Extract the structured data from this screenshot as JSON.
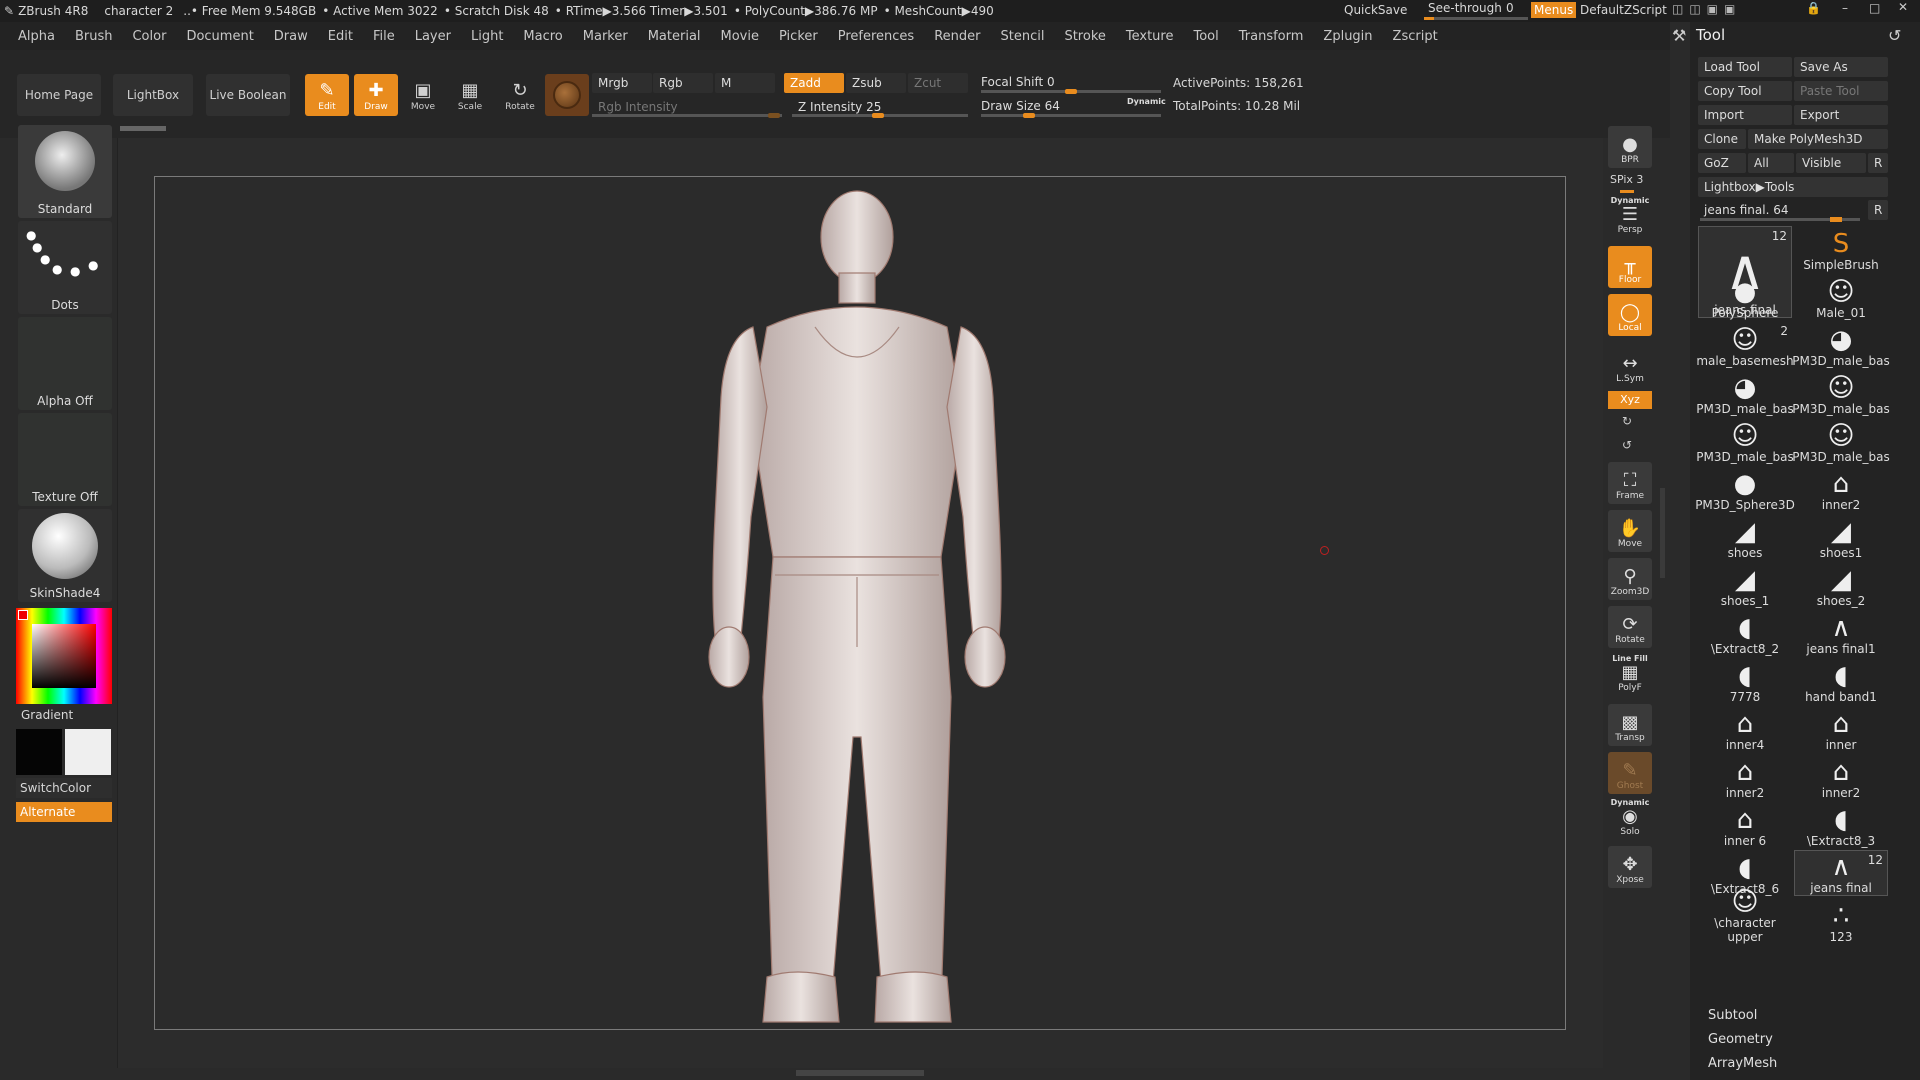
{
  "titlebar": {
    "app": "ZBrush 4R8",
    "doc": "character  2",
    "free_mem": "..• Free Mem 9.548GB",
    "active_mem": "• Active Mem 3022",
    "scratch": "• Scratch Disk 48",
    "rtime": "• RTime▶3.566 Timer▶3.501",
    "polycount": "• PolyCount▶386.76 MP",
    "meshcount": "• MeshCount▶490",
    "quicksave": "QuickSave",
    "seethrough": "See-through",
    "seethrough_value": "0",
    "menus": "Menus",
    "script": "DefaultZScript"
  },
  "menubar": [
    "Alpha",
    "Brush",
    "Color",
    "Document",
    "Draw",
    "Edit",
    "File",
    "Layer",
    "Light",
    "Macro",
    "Marker",
    "Material",
    "Movie",
    "Picker",
    "Preferences",
    "Render",
    "Stencil",
    "Stroke",
    "Texture",
    "Tool",
    "Transform",
    "Zplugin",
    "Zscript"
  ],
  "toolbar": {
    "home_page": "Home Page",
    "lightbox": "LightBox",
    "live_boolean": "Live Boolean",
    "edit": "Edit",
    "draw": "Draw",
    "move": "Move",
    "scale": "Scale",
    "rotate": "Rotate",
    "mrgb": "Mrgb",
    "rgb": "Rgb",
    "m": "M",
    "rgb_intensity": "Rgb Intensity",
    "zadd": "Zadd",
    "zsub": "Zsub",
    "zcut": "Zcut",
    "z_intensity": "Z Intensity 25",
    "focal_shift": "Focal Shift 0",
    "draw_size": "Draw Size 64",
    "dynamic": "Dynamic",
    "active_points": "ActivePoints: 158,261",
    "total_points": "TotalPoints: 10.28 Mil"
  },
  "leftshelf": {
    "brush": "Standard",
    "stroke": "Dots",
    "alpha": "Alpha Off",
    "texture": "Texture Off",
    "material": "SkinShade4",
    "gradient": "Gradient",
    "switch_color": "SwitchColor",
    "alternate": "Alternate"
  },
  "rightshelf": {
    "bpr": "BPR",
    "spix": "SPix 3",
    "dynamic": "Dynamic",
    "persp": "Persp",
    "floor": "Floor",
    "local": "Local",
    "lsym": "L.Sym",
    "xyz": "Xyz",
    "frame": "Frame",
    "move": "Move",
    "zoom3d": "Zoom3D",
    "rotate": "Rotate",
    "line_fill": "Line Fill",
    "polyf": "PolyF",
    "transp": "Transp",
    "ghost": "Ghost",
    "dynamic2": "Dynamic",
    "solo": "Solo",
    "xpose": "Xpose"
  },
  "toolpanel": {
    "title": "Tool",
    "load_tool": "Load Tool",
    "save_as": "Save As",
    "copy_tool": "Copy Tool",
    "paste_tool": "Paste Tool",
    "import": "Import",
    "export": "Export",
    "clone": "Clone",
    "make_polymesh": "Make PolyMesh3D",
    "goz": "GoZ",
    "all": "All",
    "visible": "Visible",
    "r": "R",
    "lightbox_tools": "Lightbox▶Tools",
    "current_tool": "jeans final. 64",
    "r2": "R",
    "tools": [
      {
        "label": "jeans final",
        "count": "12",
        "icon": "pants"
      },
      {
        "label": "SimpleBrush",
        "count": "",
        "icon": "s-brush"
      },
      {
        "label": "PolySphere",
        "count": "",
        "icon": "sphere"
      },
      {
        "label": "Male_01",
        "count": "",
        "icon": "figure"
      },
      {
        "label": "male_basemesh",
        "count": "2",
        "icon": "figure"
      },
      {
        "label": "PM3D_male_bas",
        "count": "",
        "icon": "head"
      },
      {
        "label": "PM3D_male_bas",
        "count": "",
        "icon": "head"
      },
      {
        "label": "PM3D_male_bas",
        "count": "",
        "icon": "figure"
      },
      {
        "label": "PM3D_male_bas",
        "count": "",
        "icon": "figure"
      },
      {
        "label": "PM3D_male_bas",
        "count": "",
        "icon": "figure"
      },
      {
        "label": "PM3D_Sphere3D",
        "count": "",
        "icon": "sphere"
      },
      {
        "label": "inner2",
        "count": "",
        "icon": "shirt"
      },
      {
        "label": "shoes",
        "count": "",
        "icon": "shoe"
      },
      {
        "label": "shoes1",
        "count": "",
        "icon": "shoe"
      },
      {
        "label": "shoes_1",
        "count": "",
        "icon": "shoe"
      },
      {
        "label": "shoes_2",
        "count": "",
        "icon": "shoe"
      },
      {
        "label": "\\Extract8_2",
        "count": "",
        "icon": "blob"
      },
      {
        "label": "jeans final1",
        "count": "",
        "icon": "pants"
      },
      {
        "label": "7778",
        "count": "",
        "icon": "blob"
      },
      {
        "label": "hand band1",
        "count": "",
        "icon": "blob"
      },
      {
        "label": "inner4",
        "count": "",
        "icon": "shirt"
      },
      {
        "label": "inner",
        "count": "",
        "icon": "shirt"
      },
      {
        "label": "inner2",
        "count": "",
        "icon": "shirt"
      },
      {
        "label": "inner2",
        "count": "",
        "icon": "shirt"
      },
      {
        "label": "inner 6",
        "count": "",
        "icon": "shirt"
      },
      {
        "label": "\\Extract8_3",
        "count": "",
        "icon": "blob"
      },
      {
        "label": "\\Extract8_6",
        "count": "",
        "icon": "blob"
      },
      {
        "label": "jeans final",
        "count": "12",
        "icon": "pants"
      },
      {
        "label": "\\character upper",
        "count": "",
        "icon": "figure"
      },
      {
        "label": "123",
        "count": "",
        "icon": "dots"
      }
    ],
    "subtool": "Subtool",
    "geometry": "Geometry",
    "arraymesh": "ArrayMesh"
  },
  "colors": {
    "accent": "#e98c1e",
    "bg": "#2a2a2a",
    "panel": "#232323"
  }
}
